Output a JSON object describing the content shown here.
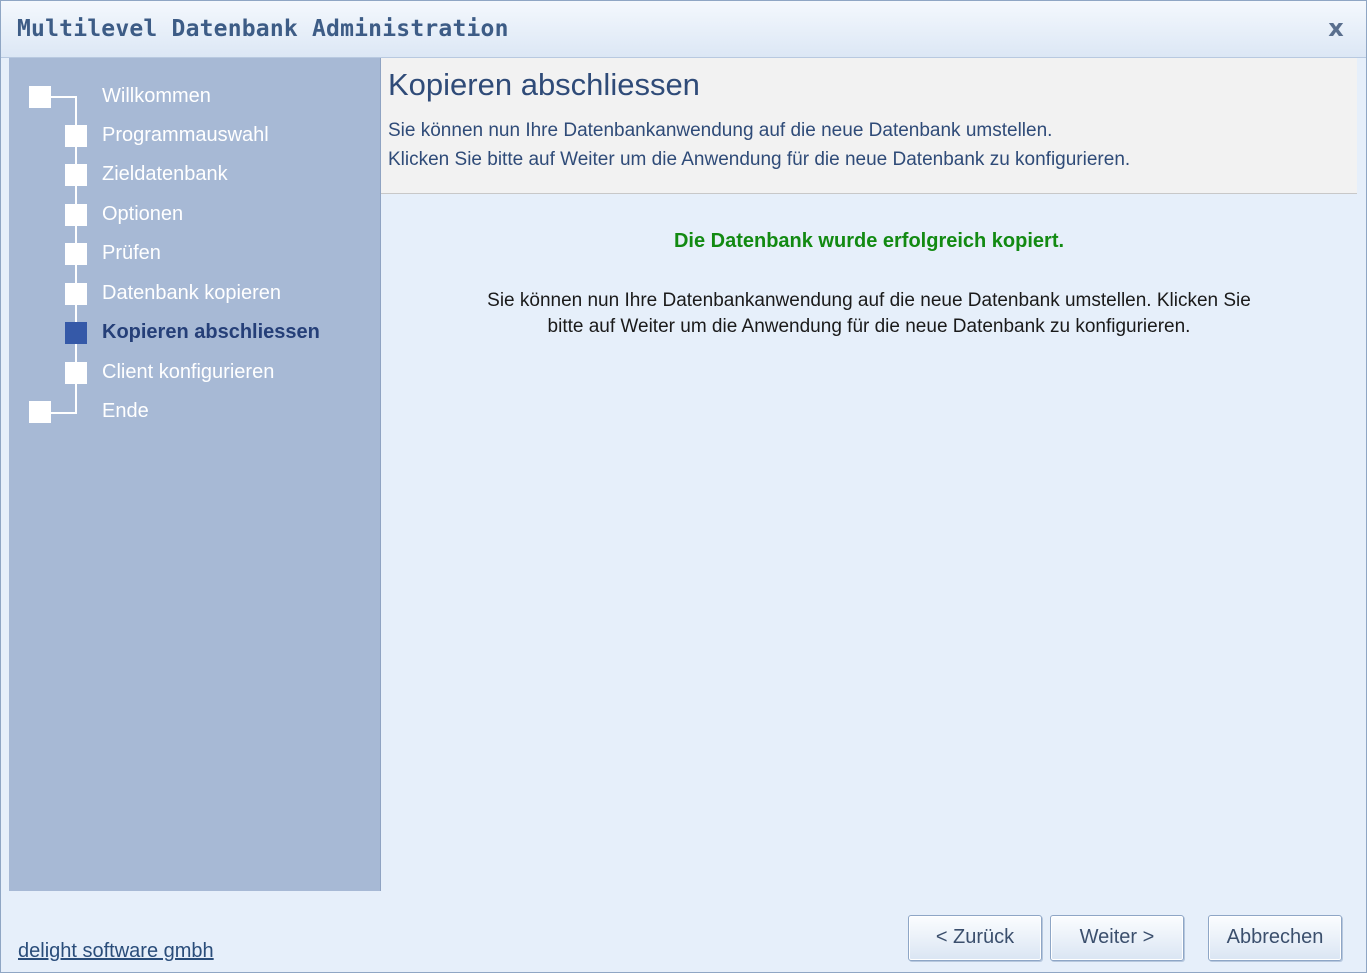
{
  "window": {
    "title": "Multilevel Datenbank Administration",
    "close_glyph": "x"
  },
  "sidebar": {
    "steps": [
      {
        "label": "Willkommen",
        "state": "done"
      },
      {
        "label": "Programmauswahl",
        "state": "done"
      },
      {
        "label": "Zieldatenbank",
        "state": "done"
      },
      {
        "label": "Optionen",
        "state": "done"
      },
      {
        "label": "Prüfen",
        "state": "done"
      },
      {
        "label": "Datenbank kopieren",
        "state": "done"
      },
      {
        "label": "Kopieren abschliessen",
        "state": "current"
      },
      {
        "label": "Client konfigurieren",
        "state": "pending"
      },
      {
        "label": "Ende",
        "state": "pending"
      }
    ]
  },
  "header": {
    "title": "Kopieren abschliessen",
    "line1": "Sie können nun Ihre Datenbankanwendung auf die neue Datenbank umstellen.",
    "line2": "Klicken Sie bitte auf Weiter um die Anwendung für die neue Datenbank zu konfigurieren."
  },
  "content": {
    "success": "Die Datenbank wurde erfolgreich kopiert.",
    "info": "Sie können nun Ihre Datenbankanwendung auf die neue Datenbank umstellen. Klicken Sie bitte auf Weiter um die Anwendung für die neue Datenbank zu konfigurieren."
  },
  "footer": {
    "link": "delight software gmbh",
    "back_label": "< Zurück",
    "next_label": "Weiter >",
    "cancel_label": "Abbrechen"
  },
  "colors": {
    "sidebar_bg": "#a7b9d5",
    "current_step": "#3559a8",
    "success_text": "#128a12",
    "title_text": "#2f4b78"
  }
}
